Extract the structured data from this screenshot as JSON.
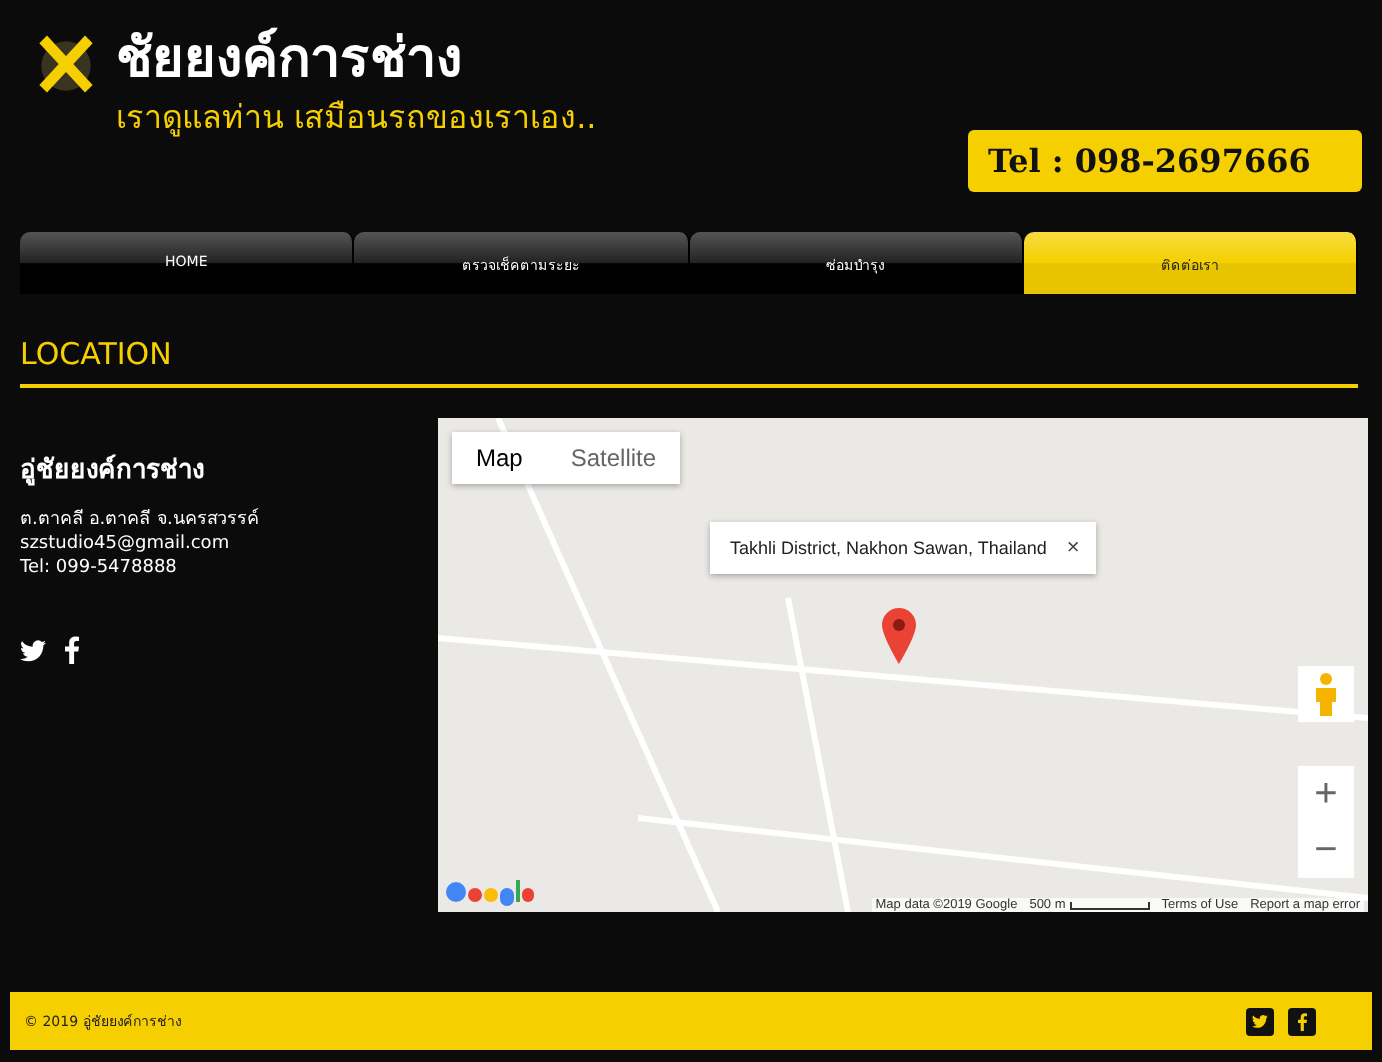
{
  "header": {
    "title": "ชัยยงค์การช่าง",
    "tagline": "เราดูแลท่าน เสมือนรถของเราเอง..",
    "phone": "Tel : 098-2697666"
  },
  "nav": [
    {
      "label": "HOME",
      "selected": false
    },
    {
      "label": "ตรวจเช็คตามระยะ",
      "selected": false
    },
    {
      "label": "ซ่อมบำรุง",
      "selected": false
    },
    {
      "label": "ติดต่อเรา",
      "selected": true
    }
  ],
  "section_title": "LOCATION",
  "contact": {
    "name": "อู่ชัยยงค์การช่าง",
    "address": "ต.ตาคลี อ.ตาคลี จ.นครสวรรค์",
    "email": "szstudio45@gmail.com",
    "phone": "Tel: 099-5478888"
  },
  "map": {
    "types": [
      {
        "label": "Map",
        "selected": true
      },
      {
        "label": "Satellite",
        "selected": false
      }
    ],
    "info": "Takhli District, Nakhon Sawan, Thailand",
    "close": "×",
    "zoom_in": "+",
    "zoom_out": "−",
    "attribution": [
      "Map data ©2019 Google",
      "500 m",
      "Terms of Use",
      "Report a map error"
    ]
  },
  "footer": {
    "copyright": "© 2019 อู่ชัยยงค์การช่าง"
  }
}
